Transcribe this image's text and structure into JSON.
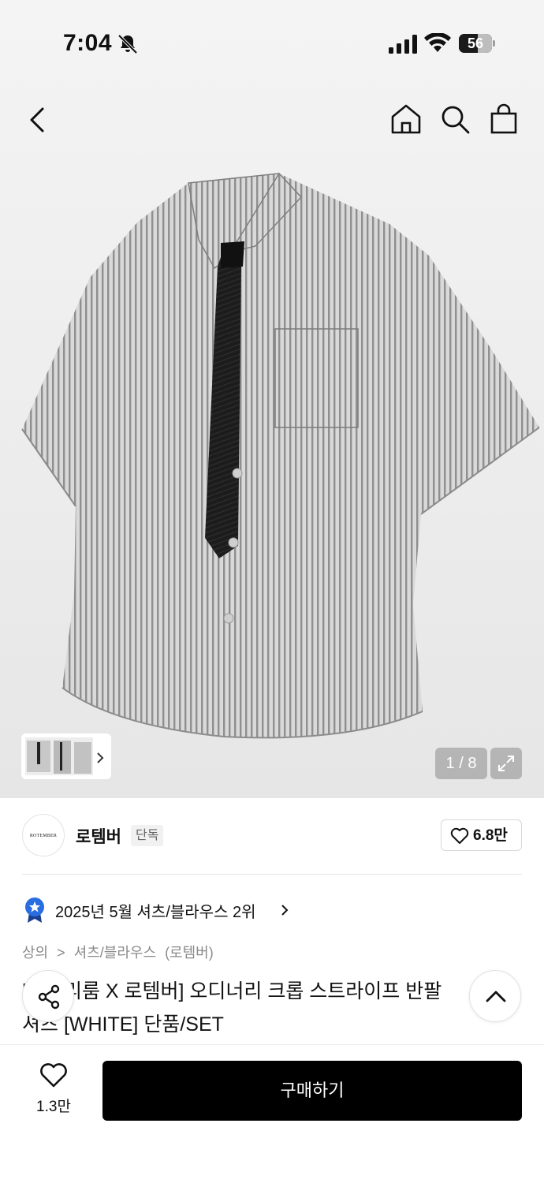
{
  "status_bar": {
    "time": "7:04",
    "battery_level": 56,
    "battery_label": "56",
    "icons": [
      "bell-slash-icon",
      "cellular-signal-icon",
      "wifi-icon",
      "battery-icon"
    ]
  },
  "top_nav": {
    "icons": [
      "back-chevron-icon",
      "home-icon",
      "search-icon",
      "shopping-bag-icon"
    ]
  },
  "gallery": {
    "page_indicator": "1 / 8",
    "current_page": 1,
    "total_pages": 8,
    "expand_icon": "expand-arrows-icon",
    "thumbnail_chevron_icon": "chevron-right-icon"
  },
  "brand": {
    "logo_text": "ROTEMBER",
    "name": "로템버",
    "tag": "단독",
    "like_count": "6.8만",
    "like_icon": "heart-outline-icon"
  },
  "ranking": {
    "badge_icon": "star-badge-icon",
    "text": "2025년 5월 셔츠/블라우스 2위",
    "chevron_icon": "chevron-right-icon"
  },
  "breadcrumb": {
    "items": [
      "상의",
      "셔츠/블라우스",
      "(로템버)"
    ],
    "separator": ">"
  },
  "product": {
    "title_line1": "[빅피리룸 X 로템버] 오디너리 크롭 스트라이프 반팔",
    "title_line2": "셔츠 [WHITE] 단품/SET"
  },
  "floating": {
    "share_icon": "share-icon",
    "scroll_top_icon": "chevron-up-icon"
  },
  "bottom_bar": {
    "favorite_icon": "heart-outline-icon",
    "favorite_count": "1.3만",
    "buy_label": "구매하기"
  },
  "colors": {
    "primary_button": "#000000",
    "background": "#ffffff",
    "muted_text": "#8a8a8a",
    "rank_badge": "#2a6de0"
  }
}
